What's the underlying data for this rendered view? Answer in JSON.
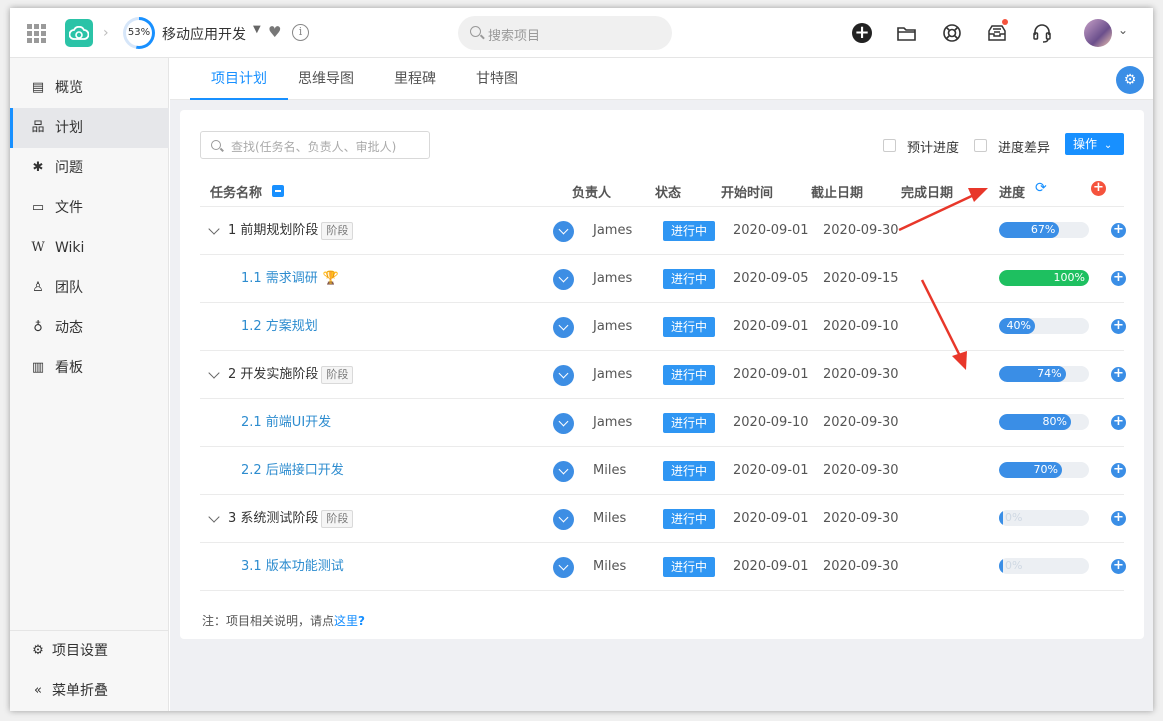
{
  "header": {
    "progress_ring": "53%",
    "progress_ring_value": 53,
    "project_name": "移动应用开发",
    "search_placeholder": "搜索项目",
    "icons": [
      "grid-icon",
      "app-logo-icon",
      "heart-icon",
      "info-icon",
      "add-icon",
      "folder-icon",
      "lifebuoy-icon",
      "inbox-icon",
      "headset-icon",
      "avatar"
    ]
  },
  "sidebar": {
    "items": [
      {
        "label": "概览",
        "icon": "overview-icon"
      },
      {
        "label": "计划",
        "icon": "plan-icon"
      },
      {
        "label": "问题",
        "icon": "bug-icon"
      },
      {
        "label": "文件",
        "icon": "folder-icon"
      },
      {
        "label": "Wiki",
        "icon": "wiki-icon"
      },
      {
        "label": "团队",
        "icon": "team-icon"
      },
      {
        "label": "动态",
        "icon": "activity-icon"
      },
      {
        "label": "看板",
        "icon": "chart-icon"
      }
    ],
    "active_index": 1,
    "settings_label": "项目设置",
    "collapse_label": "菜单折叠"
  },
  "tabs": [
    {
      "label": "项目计划"
    },
    {
      "label": "思维导图"
    },
    {
      "label": "里程碑"
    },
    {
      "label": "甘特图"
    }
  ],
  "toolbar": {
    "filter_placeholder": "查找(任务名、负责人、审批人)",
    "estimate_label": "预计进度",
    "diff_label": "进度差异",
    "action_label": "操作"
  },
  "table": {
    "headers": {
      "name": "任务名称",
      "owner": "负责人",
      "status": "状态",
      "start": "开始时间",
      "end": "截止日期",
      "done": "完成日期",
      "progress": "进度"
    },
    "rows": [
      {
        "name": "1 前期规划阶段",
        "stage": true,
        "stage_tag": "阶段",
        "owner": "James",
        "status": "进行中",
        "start": "2020-09-01",
        "end": "2020-09-30",
        "progress": 67,
        "progress_label": "67%",
        "bar_color": "#3a8ee6"
      },
      {
        "name": "1.1 需求调研",
        "stage": false,
        "trophy": true,
        "owner": "James",
        "status": "进行中",
        "start": "2020-09-05",
        "end": "2020-09-15",
        "progress": 100,
        "progress_label": "100%",
        "bar_color": "#1ec060"
      },
      {
        "name": "1.2 方案规划",
        "stage": false,
        "owner": "James",
        "status": "进行中",
        "start": "2020-09-01",
        "end": "2020-09-10",
        "progress": 40,
        "progress_label": "40%",
        "bar_color": "#3a8ee6"
      },
      {
        "name": "2 开发实施阶段",
        "stage": true,
        "stage_tag": "阶段",
        "owner": "James",
        "status": "进行中",
        "start": "2020-09-01",
        "end": "2020-09-30",
        "progress": 74,
        "progress_label": "74%",
        "bar_color": "#3a8ee6"
      },
      {
        "name": "2.1 前端UI开发",
        "stage": false,
        "owner": "James",
        "status": "进行中",
        "start": "2020-09-10",
        "end": "2020-09-30",
        "progress": 80,
        "progress_label": "80%",
        "bar_color": "#3a8ee6"
      },
      {
        "name": "2.2 后端接口开发",
        "stage": false,
        "owner": "Miles",
        "status": "进行中",
        "start": "2020-09-01",
        "end": "2020-09-30",
        "progress": 70,
        "progress_label": "70%",
        "bar_color": "#3a8ee6"
      },
      {
        "name": "3 系统测试阶段",
        "stage": true,
        "stage_tag": "阶段",
        "owner": "Miles",
        "status": "进行中",
        "start": "2020-09-01",
        "end": "2020-09-30",
        "progress": 0,
        "progress_label": "0%",
        "bar_color": "#3a8ee6"
      },
      {
        "name": "3.1 版本功能测试",
        "stage": false,
        "owner": "Miles",
        "status": "进行中",
        "start": "2020-09-01",
        "end": "2020-09-30",
        "progress": 0,
        "progress_label": "0%",
        "bar_color": "#3a8ee6"
      }
    ]
  },
  "note": {
    "text": "注：项目相关说明，请点",
    "link": "这里",
    "link_suffix": "?"
  },
  "colors": {
    "accent": "#1890ff",
    "status_bg": "#2f96f3",
    "success": "#1ec060",
    "arrow": "#e8372a",
    "logo": "#2bc3a7"
  }
}
